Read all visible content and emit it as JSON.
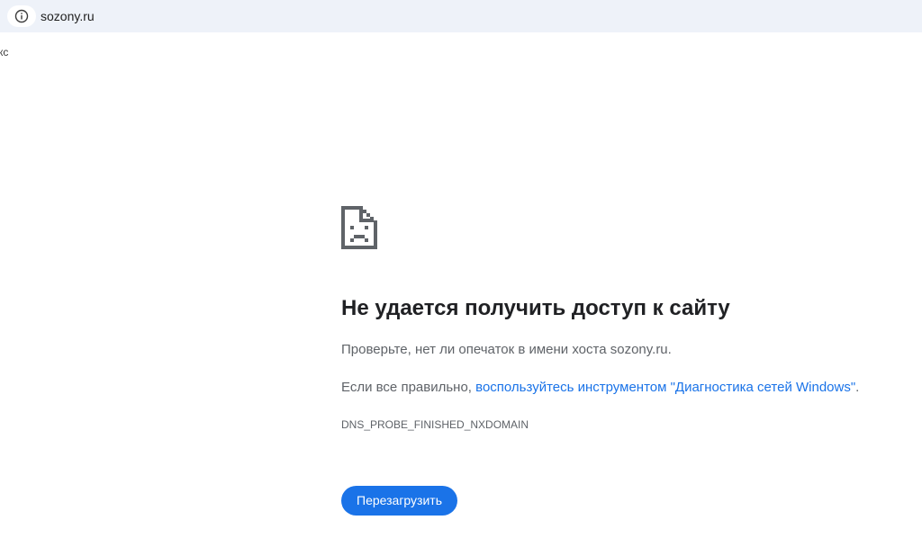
{
  "browser": {
    "url": "sozony.ru",
    "bookmark_fragment": "кс",
    "icons": {
      "site_info": "info-circle-icon"
    }
  },
  "error_page": {
    "icon": "sad-document-icon",
    "title": "Не удается получить доступ к сайту",
    "hint_typo": "Проверьте, нет ли опечаток в имени хоста sozony.ru.",
    "hint_diag_prefix": "Если все правильно, ",
    "hint_diag_link": "воспользуйтесь инструментом \"Диагностика сетей Windows\"",
    "hint_diag_suffix": ".",
    "error_code": "DNS_PROBE_FINISHED_NXDOMAIN",
    "reload_label": "Перезагрузить"
  },
  "colors": {
    "address_bar_bg": "#eef2f9",
    "link": "#1a73e8",
    "button_bg": "#1a73e8",
    "title": "#202124",
    "secondary_text": "#5f6368"
  }
}
